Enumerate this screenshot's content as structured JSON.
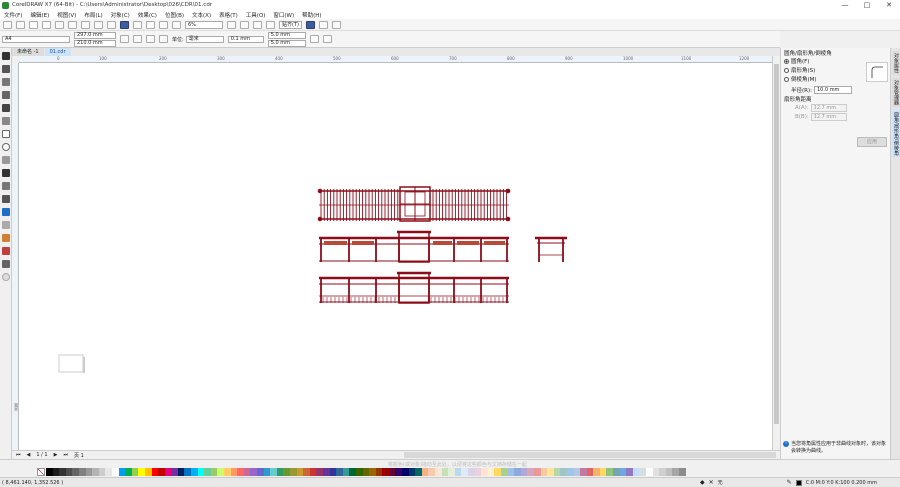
{
  "window": {
    "title": "CorelDRAW X7 (64-Bit) - C:\\Users\\Administrator\\Desktop\\026\\CDR\\01.cdr",
    "controls": [
      "—",
      "□",
      "✕"
    ]
  },
  "menu": [
    "文件(F)",
    "编辑(E)",
    "视图(V)",
    "布局(L)",
    "对象(C)",
    "效果(C)",
    "位图(B)",
    "文本(X)",
    "表格(T)",
    "工具(O)",
    "窗口(W)",
    "帮助(H)"
  ],
  "toolbar": {
    "zoom": "6%",
    "snap_label": "贴齐(T)"
  },
  "propbar": {
    "page_size": "A4",
    "width": "297.0 mm",
    "height": "210.0 mm",
    "units_label": "单位:",
    "units": "毫米",
    "nudge": "0.1 mm",
    "dup_x": "5.0 mm",
    "dup_y": "5.0 mm"
  },
  "tabs": [
    {
      "label": "未命名 -1",
      "active": false
    },
    {
      "label": "01.cdr",
      "active": true
    }
  ],
  "rulers": {
    "h_labels": [
      "0",
      "100",
      "200",
      "300",
      "400",
      "500",
      "600",
      "700",
      "800",
      "900",
      "1000",
      "1100",
      "1200"
    ],
    "unit": "毫米"
  },
  "page_nav": {
    "counter": "1 / 1",
    "page_tab": "页 1"
  },
  "docker": {
    "title": "圆角/扇形角/倒棱角",
    "options": [
      {
        "label": "圆角(F)",
        "selected": true
      },
      {
        "label": "扇形角(S)",
        "selected": false
      },
      {
        "label": "倒棱角(M)",
        "selected": false
      }
    ],
    "radius_label": "半径(R):",
    "radius": "10.0 mm",
    "distance_title": "扇形角距离",
    "a_label": "A(A):",
    "a_value": "12.7 mm",
    "b_label": "B(B):",
    "b_value": "12.7 mm",
    "apply": "应用",
    "hint": "当您将角属性应用于非曲线对象时，该对象会转换为曲线。"
  },
  "side_tabs": [
    "对象属性",
    "对象管理器",
    "圆角/扇形角/倒棱角"
  ],
  "palette": {
    "hint": "将颜色(或对象)拖动至此处，以便将这些颜色与文档存储在一起",
    "colors": [
      "#000000",
      "#1a1a1a",
      "#333333",
      "#4d4d4d",
      "#666666",
      "#808080",
      "#999999",
      "#b3b3b3",
      "#cccccc",
      "#e6e6e6",
      "#ffffff",
      "#00a0e9",
      "#00b050",
      "#92d050",
      "#ffff00",
      "#ffc000",
      "#ff0000",
      "#c00000",
      "#e4007f",
      "#7030a0",
      "#002060",
      "#0070c0",
      "#00b0f0",
      "#00ffff",
      "#66cc99",
      "#99cc66",
      "#ccff66",
      "#ffcc66",
      "#ff9966",
      "#ff6666",
      "#cc6699",
      "#9966cc",
      "#6666cc",
      "#3399cc",
      "#66cccc",
      "#339966",
      "#669933",
      "#999933",
      "#cc9933",
      "#cc6633",
      "#cc3333",
      "#993366",
      "#663399",
      "#333399",
      "#336699",
      "#339999",
      "#006633",
      "#336600",
      "#666600",
      "#996600",
      "#993300",
      "#990000",
      "#660033",
      "#330066",
      "#000066",
      "#003366",
      "#006666",
      "#f4b183",
      "#f8cbad",
      "#fbe5d6",
      "#c5e0b4",
      "#e2f0d9",
      "#bdd7ee",
      "#deebf7",
      "#d9d2e9",
      "#ead1dc",
      "#fce4d6",
      "#fff2cc",
      "#ffd966",
      "#a9d08e",
      "#9bc2e6",
      "#8ea9db",
      "#b4a7d6",
      "#d5a6bd",
      "#ea9999",
      "#f9cb9c",
      "#ffe599",
      "#b6d7a8",
      "#a2c4c9",
      "#9fc5e8",
      "#b4c7e7",
      "#c27ba0",
      "#e06666",
      "#f6b26b",
      "#ffd966",
      "#93c47d",
      "#76a5af",
      "#6fa8dc",
      "#8e7cc3",
      "#c9daf8",
      "#d0e0e3",
      "#fff",
      "#e0e0e0",
      "#cfcfcf",
      "#bfbfbf",
      "#a6a6a6",
      "#8c8c8c"
    ]
  },
  "status": {
    "coords": "( 8,461.140, 1,352.526 )",
    "fill_info": "C:0 M:0 Y:0 K:100  0.200 mm",
    "outline_label": "无"
  },
  "colors": {
    "drawing": "#8b0d1a",
    "accent": "#1e6fc8"
  }
}
